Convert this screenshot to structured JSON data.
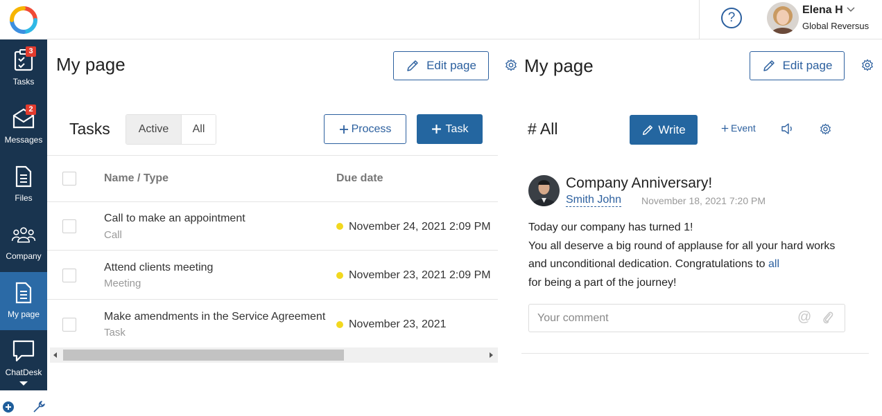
{
  "nav": {
    "items": [
      {
        "label": "Tasks",
        "badge": "3"
      },
      {
        "label": "Messages",
        "badge": "2"
      },
      {
        "label": "Files"
      },
      {
        "label": "Company"
      },
      {
        "label": "My page"
      },
      {
        "label": "ChatDesk"
      }
    ]
  },
  "header": {
    "help": "?",
    "user_name": "Elena H",
    "user_company": "Global Reversus"
  },
  "left_page": {
    "title": "My page",
    "edit_label": "Edit page"
  },
  "right_page": {
    "title": "My page",
    "edit_label": "Edit page"
  },
  "tasks": {
    "title": "Tasks",
    "filters": [
      "Active",
      "All"
    ],
    "process_label": "Process",
    "task_label": "Task",
    "columns": [
      "Name / Type",
      "Due date"
    ],
    "rows": [
      {
        "name": "Call to make an appointment",
        "type": "Call",
        "due": "November 24, 2021 2:09 PM"
      },
      {
        "name": "Attend clients meeting",
        "type": "Meeting",
        "due": "November 23, 2021 2:09 PM"
      },
      {
        "name": "Make amendments in the Service Agreement",
        "type": "Task",
        "due": "November 23, 2021"
      }
    ]
  },
  "feed": {
    "title": "# All",
    "write_label": "Write",
    "event_label": "Event",
    "post": {
      "title": "Company Anniversary!",
      "author": "Smith John",
      "date": "November 18, 2021 7:20 PM",
      "line1": "Today our company has turned 1!",
      "line2": "You all deserve a big round of applause for all your hard works and unconditional dedication. Congratulations to",
      "mention": "all",
      "line3": "for being a part of the journey!"
    },
    "comment_placeholder": "Your comment"
  },
  "colors": {
    "nav_bg": "#19344f",
    "nav_active": "#2b6aa6",
    "accent": "#2466a0",
    "badge": "#e23b2e",
    "due_dot": "#f2d81f"
  }
}
